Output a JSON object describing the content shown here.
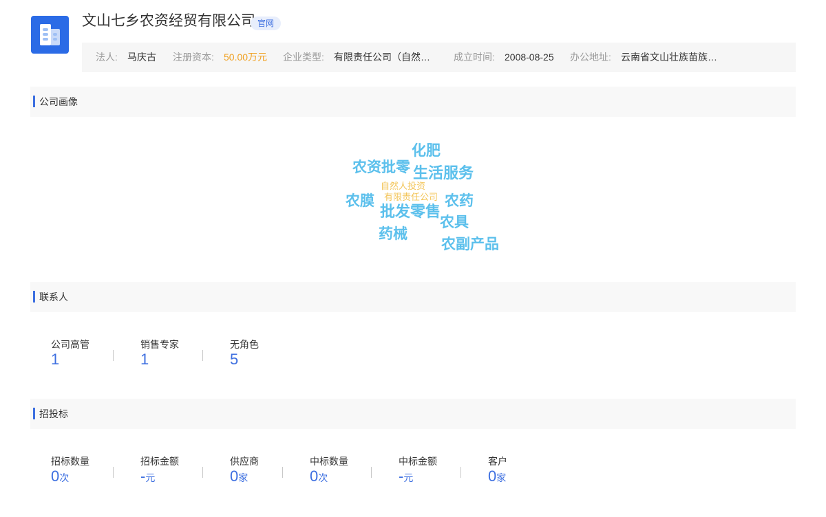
{
  "company": {
    "name": "文山七乡农资经贸有限公司",
    "official_badge": "官网"
  },
  "info": {
    "legal_person_label": "法人:",
    "legal_person": "马庆古",
    "capital_label": "注册资本:",
    "capital": "50.00万元",
    "type_label": "企业类型:",
    "type": "有限责任公司（自然…",
    "founded_label": "成立时间:",
    "founded": "2008-08-25",
    "address_label": "办公地址:",
    "address": "云南省文山壮族苗族…"
  },
  "sections": {
    "portrait": "公司画像",
    "contacts": "联系人",
    "bidding": "招投标"
  },
  "wordcloud": {
    "words": [
      "化肥",
      "农资批零",
      "生活服务",
      "自然人投资",
      "有限责任公司",
      "农膜",
      "批发零售",
      "农药",
      "农具",
      "药械",
      "农副产品"
    ]
  },
  "contacts": [
    {
      "label": "公司高管",
      "value": "1"
    },
    {
      "label": "销售专家",
      "value": "1"
    },
    {
      "label": "无角色",
      "value": "5"
    }
  ],
  "bidding": [
    {
      "label": "招标数量",
      "value": "0",
      "unit": "次"
    },
    {
      "label": "招标金额",
      "value": "-",
      "unit": "元"
    },
    {
      "label": "供应商",
      "value": "0",
      "unit": "家"
    },
    {
      "label": "中标数量",
      "value": "0",
      "unit": "次"
    },
    {
      "label": "中标金额",
      "value": "-",
      "unit": "元"
    },
    {
      "label": "客户",
      "value": "0",
      "unit": "家"
    }
  ],
  "colors": {
    "accent": "#3d6fe0",
    "logo_bg": "#2b6be6",
    "capital": "#f0a020",
    "word_blue": "#5cc0ec",
    "word_yellow": "#f3c55a"
  }
}
